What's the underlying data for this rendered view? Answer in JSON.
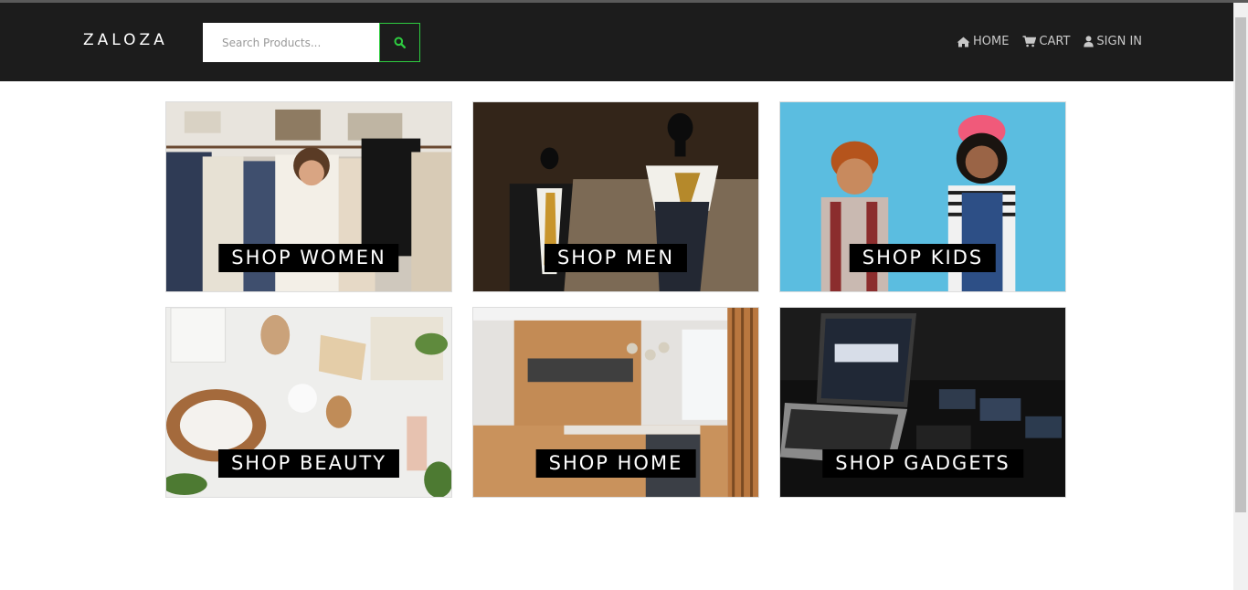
{
  "brand": "ZALOZA",
  "search": {
    "placeholder": "Search Products..."
  },
  "nav": [
    {
      "label": "HOME",
      "icon": "home-icon"
    },
    {
      "label": "CART",
      "icon": "cart-icon"
    },
    {
      "label": "SIGN IN",
      "icon": "user-icon"
    }
  ],
  "categories": [
    {
      "label": "SHOP WOMEN"
    },
    {
      "label": "SHOP MEN"
    },
    {
      "label": "SHOP KIDS"
    },
    {
      "label": "SHOP BEAUTY"
    },
    {
      "label": "SHOP HOME"
    },
    {
      "label": "SHOP GADGETS"
    }
  ],
  "colors": {
    "navbar": "#1c1c1c",
    "accent": "#2ecc40",
    "label_bg": "#000000"
  }
}
